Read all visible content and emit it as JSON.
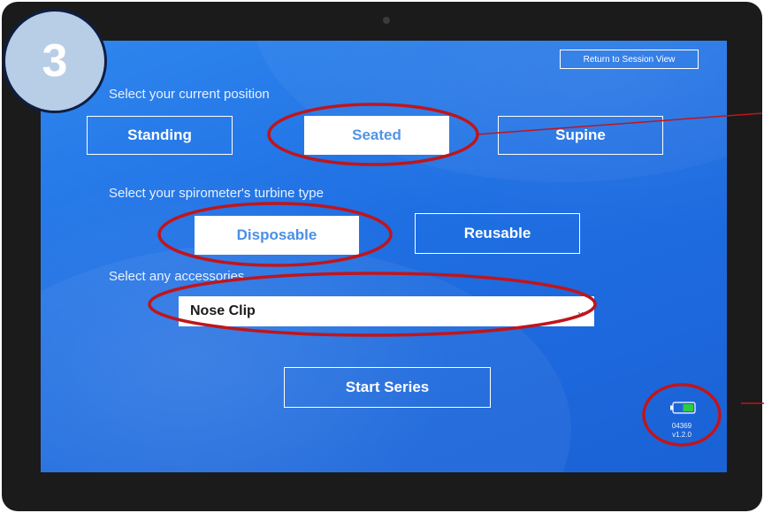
{
  "step_number": "3",
  "header": {
    "return_label": "Return to Session View"
  },
  "position": {
    "prompt": "Select your current position",
    "options": [
      "Standing",
      "Seated",
      "Supine"
    ],
    "selected": "Seated"
  },
  "turbine": {
    "prompt": "Select your spirometer's turbine type",
    "options": [
      "Disposable",
      "Reusable"
    ],
    "selected": "Disposable"
  },
  "accessories": {
    "prompt": "Select any accessories",
    "selected_value": "Nose Clip"
  },
  "actions": {
    "start_label": "Start Series"
  },
  "device": {
    "battery_level": 0.5,
    "battery_color": "#2ecc40",
    "id": "04369",
    "version": "v1.2.0"
  },
  "colors": {
    "screen_blue": "#1f6fe3",
    "selected_text": "#4a8fe6",
    "annotation_red": "#c0151b"
  }
}
